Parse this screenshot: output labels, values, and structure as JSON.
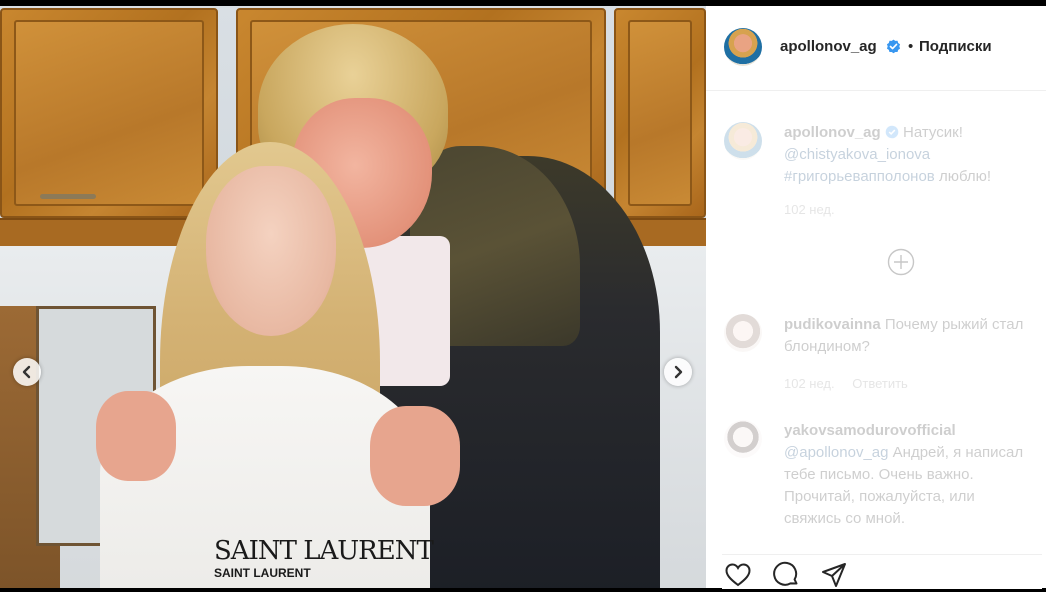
{
  "post": {
    "username": "apollonov_ag",
    "separator": "•",
    "follow_label": "Подписки"
  },
  "caption": {
    "username": "apollonov_ag",
    "text_1": "Натусик!",
    "mention": "@chistyakova_ionova",
    "hashtag": "#григорьевапполонов",
    "text_2": "люблю!",
    "time": "102 нед."
  },
  "comments": [
    {
      "username": "pudikovainna",
      "text": "Почему рыжий стал блондином?",
      "time": "102 нед.",
      "reply_label": "Ответить"
    },
    {
      "username": "yakovsamodurovofficial",
      "mention": "@apollonov_ag",
      "text": "Андрей, я написал тебе письмо. Очень важно. Прочитай, пожалуйста, или свяжись со мной."
    }
  ],
  "photo": {
    "sweater_big": "SAINT LAURENT",
    "sweater_small": "SAINT LAURENT"
  },
  "icons": {
    "prev": "chevron-left-icon",
    "next": "chevron-right-icon",
    "verified": "verified-badge-icon",
    "load_more": "plus-circle-icon",
    "like": "heart-icon",
    "comment": "comment-icon",
    "share": "paper-plane-icon"
  },
  "colors": {
    "link": "#003569",
    "verified": "#3897f0",
    "meta": "#8e8e8e",
    "text": "#262626"
  }
}
